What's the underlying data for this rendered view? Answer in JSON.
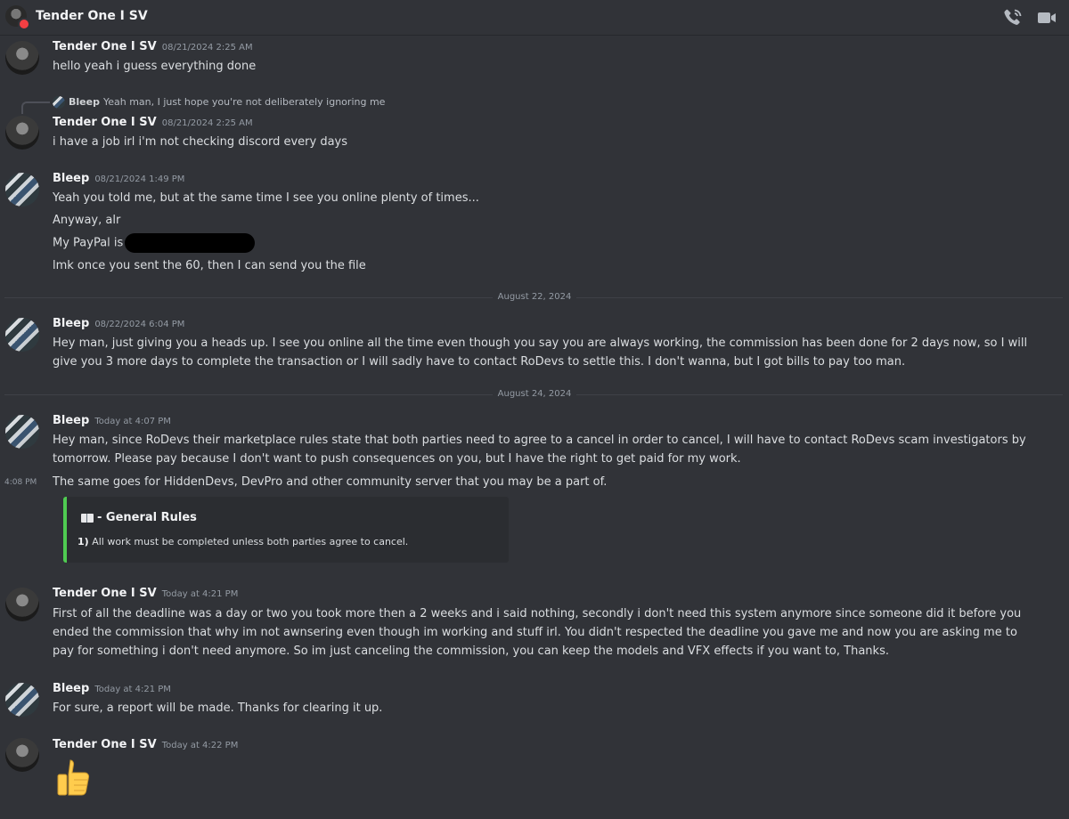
{
  "header": {
    "title": "Tender One I SV",
    "icons": [
      "phone-call-icon",
      "video-camera-icon"
    ]
  },
  "messages": {
    "m1": {
      "author": "Tender One I SV",
      "time": "08/21/2024 2:25 AM",
      "text": "hello yeah i guess everything done"
    },
    "reply": {
      "author": "Bleep",
      "text": "Yeah man, I just hope you're not deliberately ignoring me"
    },
    "m2": {
      "author": "Tender One I SV",
      "time": "08/21/2024 2:25 AM",
      "text": "i have a job irl i'm not checking discord every days"
    },
    "m3": {
      "author": "Bleep",
      "time": "08/21/2024 1:49 PM",
      "line1": "Yeah you told me, but at the same time I see you online plenty of times...",
      "line2": "Anyway, alr",
      "line3": "My PayPal is",
      "line4": "lmk once you sent the 60, then I can send you the file"
    },
    "divider1": "August 22, 2024",
    "m4": {
      "author": "Bleep",
      "time": "08/22/2024 6:04 PM",
      "text": "Hey man, just giving you a heads up. I see you online all the time even though you say you are always working, the commission has been done for 2 days now, so I will give you 3 more days to complete the transaction or I will sadly have to contact RoDevs to settle this. I don't wanna, but I got bills to pay too man."
    },
    "divider2": "August 24, 2024",
    "m5": {
      "author": "Bleep",
      "time": "Today at 4:07 PM",
      "text": "Hey man, since RoDevs their marketplace rules state that both parties need to agree to a cancel in order to cancel, I will have to contact RoDevs scam investigators by tomorrow. Please pay because I don't want to push consequences on you, but I have the right to get paid for my work."
    },
    "m6": {
      "hover_time": "4:08 PM",
      "text": "The same goes for HiddenDevs, DevPro and other community server that you may be a part of."
    },
    "embed": {
      "title": "- General Rules",
      "number": "1)",
      "text": "All work must be completed unless both parties agree to cancel.",
      "accent": "#4fcb51"
    },
    "m7": {
      "author": "Tender One I SV",
      "time": "Today at 4:21 PM",
      "text": "First of all the deadline was a day or two you took more then a 2 weeks and i said nothing, secondly i don't need this system anymore since someone did it before you ended the commission that why im not awnsering even though im working and stuff irl. You didn't respected the deadline you gave me and now you are asking me to pay for something i don't need anymore. So im just canceling the commission, you can keep the models and VFX effects if you want to, Thanks."
    },
    "m8": {
      "author": "Bleep",
      "time": "Today at 4:21 PM",
      "text": "For sure, a report will be made. Thanks for clearing it up."
    },
    "m9": {
      "author": "Tender One I SV",
      "time": "Today at 4:22 PM",
      "emoji": "thumbs-up-icon"
    }
  },
  "colors": {
    "background": "#313338",
    "embed_accent": "#4fcb51",
    "dnd_status": "#f23f43"
  }
}
